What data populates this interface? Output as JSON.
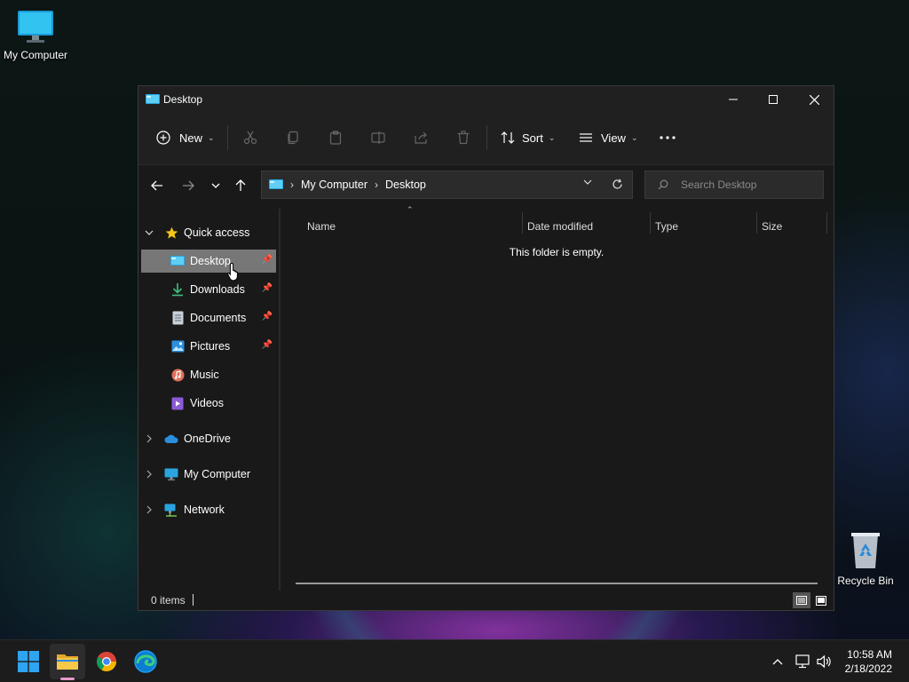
{
  "desktop": {
    "icons": [
      {
        "label": "My Computer",
        "icon": "monitor-icon"
      },
      {
        "label": "Recycle Bin",
        "icon": "recycle-bin-icon"
      }
    ]
  },
  "window": {
    "title": "Desktop",
    "controls": {
      "minimize": "minimize-icon",
      "maximize": "maximize-icon",
      "close": "close-icon"
    }
  },
  "toolbar": {
    "new_label": "New",
    "sort_label": "Sort",
    "view_label": "View",
    "disabled_actions": [
      "cut",
      "copy",
      "paste",
      "rename",
      "share",
      "delete"
    ]
  },
  "address": {
    "crumbs": [
      "My Computer",
      "Desktop"
    ]
  },
  "search": {
    "placeholder": "Search Desktop"
  },
  "sidebar": {
    "quick_access": "Quick access",
    "pinned": [
      {
        "label": "Desktop",
        "pinned": true,
        "selected": true
      },
      {
        "label": "Downloads",
        "pinned": true
      },
      {
        "label": "Documents",
        "pinned": true
      },
      {
        "label": "Pictures",
        "pinned": true
      },
      {
        "label": "Music",
        "pinned": false
      },
      {
        "label": "Videos",
        "pinned": false
      }
    ],
    "roots": [
      "OneDrive",
      "My Computer",
      "Network"
    ]
  },
  "columns": [
    "Name",
    "Date modified",
    "Type",
    "Size"
  ],
  "content": {
    "empty_message": "This folder is empty."
  },
  "status": {
    "items": "0 items"
  },
  "taskbar": {
    "apps": [
      "start-icon",
      "file-explorer-icon",
      "chrome-icon",
      "edge-icon"
    ],
    "time": "10:58 AM",
    "date": "2/18/2022"
  },
  "colors": {
    "accent": "#0078d4",
    "window_bg": "#191919",
    "selected_item": "#777777"
  }
}
